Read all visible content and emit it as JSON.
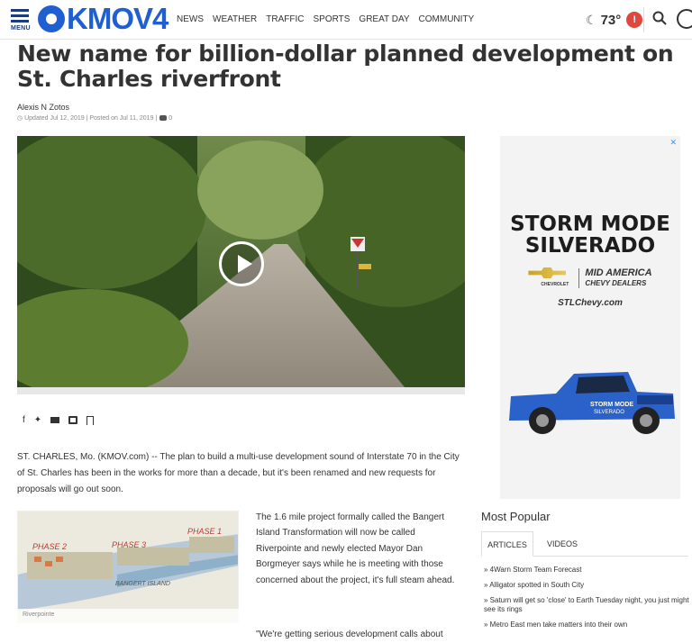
{
  "header": {
    "menu_label": "MENU",
    "logo_text": "KMOV4",
    "nav": [
      "NEWS",
      "WEATHER",
      "TRAFFIC",
      "SPORTS",
      "GREAT DAY",
      "COMMUNITY"
    ],
    "temperature": "73°",
    "alert_badge": "!"
  },
  "article": {
    "title": "New name for billion-dollar planned development on St. Charles riverfront",
    "author": "Alexis N Zotos",
    "meta": "Updated Jul 12, 2019 | Posted on Jul 11, 2019 |",
    "comment_count": "0",
    "lead": "ST. CHARLES, Mo. (KMOV.com) -- The plan to build a multi-use development sound of Interstate 70 in the City of St. Charles has been in the works for more than a decade, but it's been renamed and new requests for proposals will go out soon.",
    "para2": "The 1.6 mile project formally called the Bangert Island Transformation will now be called Riverpointe and newly elected Mayor Dan Borgmeyer says while he is meeting with those concerned about the project, it's full steam ahead.",
    "para3": "\"We're getting serious development calls about",
    "map": {
      "caption": "Riverpointe",
      "labels": [
        "PHASE 2",
        "PHASE 3",
        "PHASE 1",
        "BANGERT ISLAND"
      ]
    }
  },
  "share_icons": [
    "facebook-icon",
    "twitter-icon",
    "mail-icon",
    "print-icon",
    "bookmark-icon"
  ],
  "ad": {
    "close": "✕",
    "title_line1": "STORM MODE",
    "title_line2": "SILVERADO",
    "brand_word": "CHEVROLET",
    "dealer_line1": "MID AMERICA",
    "dealer_line2": "CHEVY DEALERS",
    "url": "STLChevy.com",
    "truck_text1": "STORM MODE",
    "truck_text2": "SILVERADO"
  },
  "popular": {
    "title": "Most Popular",
    "tabs": [
      "ARTICLES",
      "VIDEOS"
    ],
    "items": [
      "4Warn Storm Team Forecast",
      "Alligator spotted in South City",
      "Saturn will get so 'close' to Earth Tuesday night, you just might see its rings",
      "Metro East men take matters into their own"
    ]
  },
  "colors": {
    "brand_blue": "#1f5fd1",
    "alert_red": "#e0483e",
    "text": "#333333"
  }
}
